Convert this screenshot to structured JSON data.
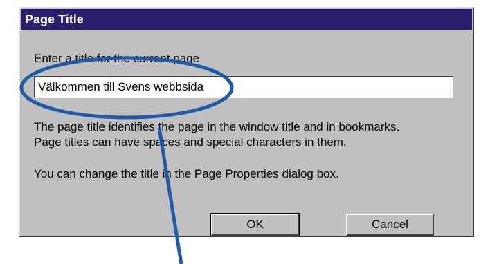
{
  "dialog": {
    "title": "Page Title",
    "prompt": "Enter a title for the current page",
    "input_value": "Välkommen till Svens webbsida",
    "description_line1": "The page title identifies the page in the window title and in bookmarks.",
    "description_line2": "Page titles can have spaces and special characters in them.",
    "hint": "You can change the title in the Page Properties dialog box.",
    "ok_label": "OK",
    "cancel_label": "Cancel"
  },
  "annotation": {
    "color": "#1f5aa8",
    "shape": "ellipse-with-pointer-line"
  }
}
